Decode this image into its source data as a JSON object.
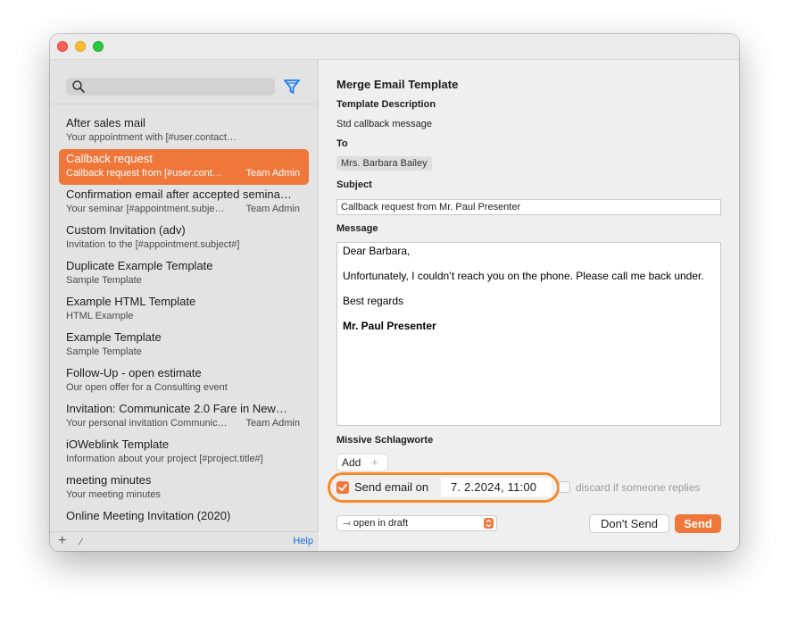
{
  "colors": {
    "accent": "#f0773a",
    "highlight_ring": "#f48a2c",
    "link": "#1a6fe0",
    "sidebar_bg": "#e3e3e3",
    "main_bg": "#efefef"
  },
  "sidebar": {
    "search": {
      "placeholder": "",
      "icon": "search-icon"
    },
    "filter_icon": "filter-icon",
    "items": [
      {
        "title": "After sales mail",
        "description": "Your appointment with [#user.contact.firstnam…",
        "owner": ""
      },
      {
        "title": "Callback request",
        "description": "Callback request from [#user.cont…",
        "owner": "Team Admin"
      },
      {
        "title": "Confirmation email after accepted semina…",
        "description": "Your seminar [#appointment.subje…",
        "owner": "Team Admin"
      },
      {
        "title": "Custom Invitation (adv)",
        "description": "Invitation to the [#appointment.subject#]",
        "owner": ""
      },
      {
        "title": "Duplicate Example Template",
        "description": "Sample Template",
        "owner": ""
      },
      {
        "title": "Example HTML Template",
        "description": "HTML Example",
        "owner": ""
      },
      {
        "title": "Example Template",
        "description": "Sample Template",
        "owner": ""
      },
      {
        "title": "Follow-Up - open estimate",
        "description": "Our open offer for a Consulting event",
        "owner": ""
      },
      {
        "title": "Invitation: Communicate 2.0 Fare in New…",
        "description": "Your personal invitation Communic…",
        "owner": "Team Admin"
      },
      {
        "title": "iOWeblink Template",
        "description": "Information about your project [#project.title#]",
        "owner": ""
      },
      {
        "title": "meeting minutes",
        "description": "Your meeting minutes",
        "owner": ""
      },
      {
        "title": "Online Meeting Invitation (2020)",
        "description": "",
        "owner": ""
      }
    ],
    "footer": {
      "add": "+",
      "edit": "⁄",
      "help": "Help"
    }
  },
  "main": {
    "title": "Merge Email Template",
    "template_description_label": "Template Description",
    "template_description": "Std callback message",
    "to_label": "To",
    "to_value": "Mrs. Barbara Bailey",
    "subject_label": "Subject",
    "subject_value": "Callback request from Mr. Paul Presenter",
    "message_label": "Message",
    "message": {
      "line1": "Dear  Barbara,",
      "line2": "Unfortunately, I couldn’t reach you on the phone. Please call me back under.",
      "line3": "Best regards",
      "line4": "Mr. Paul Presenter"
    },
    "tags_label": "Missive Schlagworte",
    "add_tag": "Add",
    "add_tag_plus": "+",
    "send_on_checked": true,
    "send_on_label": "Send email on",
    "send_date": "7.  2.2024, 11:00",
    "discard_checked": false,
    "discard_label": "discard if someone replies",
    "draft_option": "open in draft",
    "dont_send": "Don't Send",
    "send": "Send"
  }
}
